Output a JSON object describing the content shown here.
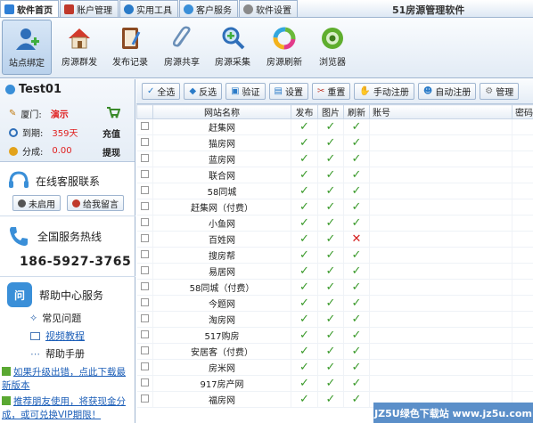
{
  "app": {
    "title": "51房源管理软件"
  },
  "tabs": [
    {
      "label": "软件首页",
      "color": "#2e7fd6"
    },
    {
      "label": "账户管理",
      "color": "#c0392b"
    },
    {
      "label": "实用工具",
      "color": "#2a7bc8"
    },
    {
      "label": "客户服务",
      "color": "#3a8fd8"
    },
    {
      "label": "软件设置",
      "color": "#8a8a8a"
    }
  ],
  "toolbar": [
    {
      "label": "站点绑定",
      "icon": "user-bind-icon"
    },
    {
      "label": "房源群发",
      "icon": "house-icon"
    },
    {
      "label": "发布记录",
      "icon": "notebook-icon"
    },
    {
      "label": "房源共享",
      "icon": "paperclip-icon"
    },
    {
      "label": "房源采集",
      "icon": "magnifier-icon"
    },
    {
      "label": "房源刷新",
      "icon": "refresh-ring-icon"
    },
    {
      "label": "浏览器",
      "icon": "browser-icon"
    }
  ],
  "user": {
    "name": "Test01",
    "city_label": "厦门:",
    "city": "演示",
    "expire_label": "到期:",
    "expire": "359天",
    "recharge": "充值",
    "share_label": "分成:",
    "share": "0.00",
    "withdraw": "提现"
  },
  "support": {
    "title": "在线客服联系",
    "btn_status": "未启用",
    "btn_message": "给我留言"
  },
  "hotline": {
    "title": "全国服务热线",
    "phone": "186-5927-3765"
  },
  "help": {
    "title": "帮助中心服务",
    "links": [
      "常见问题",
      "视频教程",
      "帮助手册"
    ]
  },
  "promos": [
    "如果升级出错，点此下载最新版本",
    "推荐朋友使用，将获现金分成，或可兑换VIP期限！"
  ],
  "actions": [
    "全选",
    "反选",
    "验证",
    "设置",
    "重置",
    "手动注册",
    "自动注册",
    "管理"
  ],
  "table": {
    "headers": [
      "网站名称",
      "发布",
      "图片",
      "刷新",
      "账号",
      "密码"
    ],
    "rows": [
      {
        "name": "赶集网",
        "pub": true,
        "img": true,
        "ref": true
      },
      {
        "name": "猫房网",
        "pub": true,
        "img": true,
        "ref": true
      },
      {
        "name": "蓝房网",
        "pub": true,
        "img": true,
        "ref": true
      },
      {
        "name": "联合网",
        "pub": true,
        "img": true,
        "ref": true
      },
      {
        "name": "58同城",
        "pub": true,
        "img": true,
        "ref": true
      },
      {
        "name": "赶集网（付费）",
        "pub": true,
        "img": true,
        "ref": true
      },
      {
        "name": "小鱼网",
        "pub": true,
        "img": true,
        "ref": true
      },
      {
        "name": "百姓网",
        "pub": true,
        "img": true,
        "ref": false
      },
      {
        "name": "搜房帮",
        "pub": true,
        "img": true,
        "ref": true
      },
      {
        "name": "易居网",
        "pub": true,
        "img": true,
        "ref": true
      },
      {
        "name": "58同城（付费）",
        "pub": true,
        "img": true,
        "ref": true
      },
      {
        "name": "今题网",
        "pub": true,
        "img": true,
        "ref": true
      },
      {
        "name": "淘房网",
        "pub": true,
        "img": true,
        "ref": true
      },
      {
        "name": "517购房",
        "pub": true,
        "img": true,
        "ref": true
      },
      {
        "name": "安居客（付费）",
        "pub": true,
        "img": true,
        "ref": true
      },
      {
        "name": "房米网",
        "pub": true,
        "img": true,
        "ref": true
      },
      {
        "name": "917房产网",
        "pub": true,
        "img": true,
        "ref": true
      },
      {
        "name": "福房网",
        "pub": true,
        "img": true,
        "ref": true
      }
    ]
  },
  "watermark": "JZ5U绿色下载站 www.jz5u.com"
}
